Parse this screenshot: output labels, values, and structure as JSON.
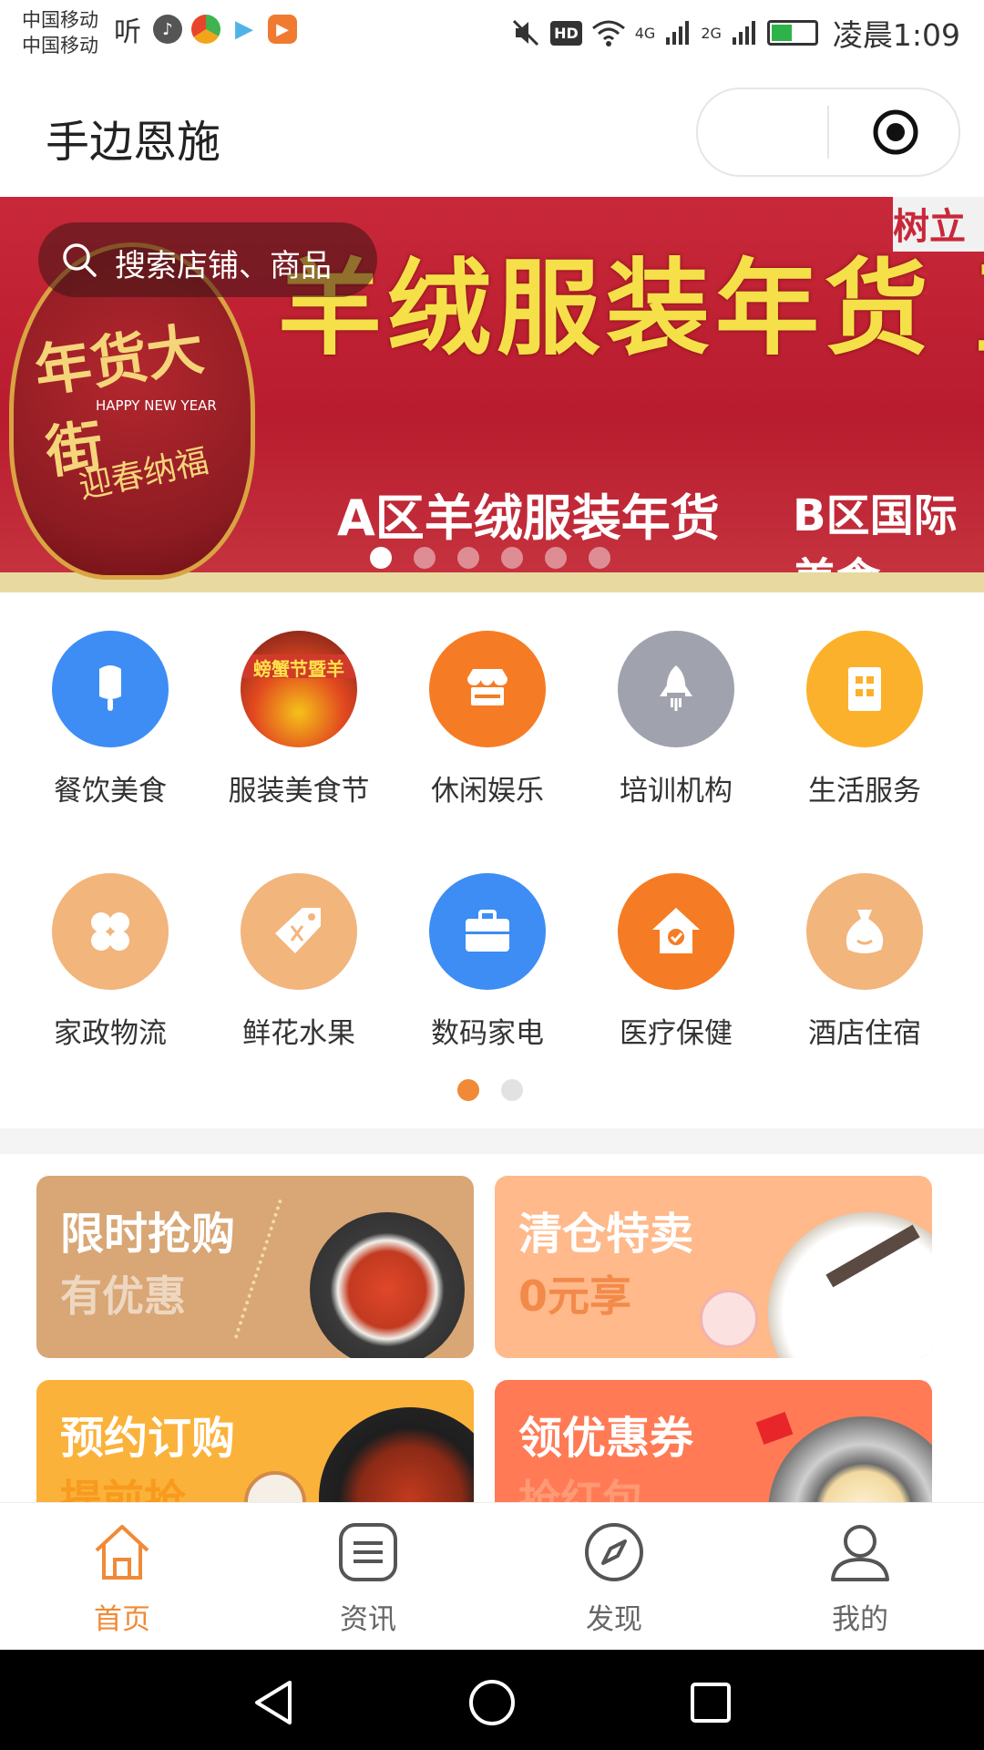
{
  "status_bar": {
    "carrier_1": "中国移动",
    "carrier_2": "中国移动",
    "signal_1": "4G",
    "signal_2": "2G",
    "time": "凌晨1:09"
  },
  "header": {
    "title": "手边恩施"
  },
  "banner": {
    "search_placeholder": "搜索店铺、商品",
    "sign_main": "羊绒服装年货 直销展欢迎您",
    "sign_a": "A区羊绒服装年货",
    "sign_b": "B区国际美食",
    "sign_corner": "树立企",
    "emblem_title": "年货大街",
    "emblem_en": "HAPPY NEW YEAR",
    "emblem_sub": "迎春纳福",
    "slide_count": 6,
    "active_slide": 0
  },
  "categories": {
    "row1": [
      {
        "label": "餐饮美食",
        "icon": "popsicle-icon",
        "color": "#3d8df5"
      },
      {
        "label": "服装美食节",
        "icon": "festival-photo",
        "color": "#b5322c"
      },
      {
        "label": "休闲娱乐",
        "icon": "shop-icon",
        "color": "#f57c24"
      },
      {
        "label": "培训机构",
        "icon": "rocket-icon",
        "color": "#a0a3ad"
      },
      {
        "label": "生活服务",
        "icon": "building-icon",
        "color": "#fbb12b"
      }
    ],
    "row2": [
      {
        "label": "家政物流",
        "icon": "clover-icon",
        "color": "#f2b57c"
      },
      {
        "label": "鲜花水果",
        "icon": "tag-icon",
        "color": "#f2b57c"
      },
      {
        "label": "数码家电",
        "icon": "briefcase-icon",
        "color": "#3d8df5"
      },
      {
        "label": "医疗保健",
        "icon": "house-heart-icon",
        "color": "#f57c24"
      },
      {
        "label": "酒店住宿",
        "icon": "money-bag-icon",
        "color": "#f2b57c"
      }
    ],
    "page_count": 2,
    "active_page": 0
  },
  "promos": [
    {
      "title": "限时抢购",
      "subtitle": "有优惠",
      "bg": "#d9a675"
    },
    {
      "title": "清仓特卖",
      "subtitle": "0元享",
      "bg": "#ffb98a"
    },
    {
      "title": "预约订购",
      "subtitle": "提前抢",
      "bg": "#fbb23a"
    },
    {
      "title": "领优惠券",
      "subtitle": "抢红包",
      "bg": "#ff7a55"
    }
  ],
  "tabs": [
    {
      "label": "首页",
      "icon": "home-icon"
    },
    {
      "label": "资讯",
      "icon": "news-icon"
    },
    {
      "label": "发现",
      "icon": "compass-icon"
    },
    {
      "label": "我的",
      "icon": "user-icon"
    }
  ],
  "colors": {
    "accent": "#f08a37",
    "tab_inactive": "#666666"
  }
}
